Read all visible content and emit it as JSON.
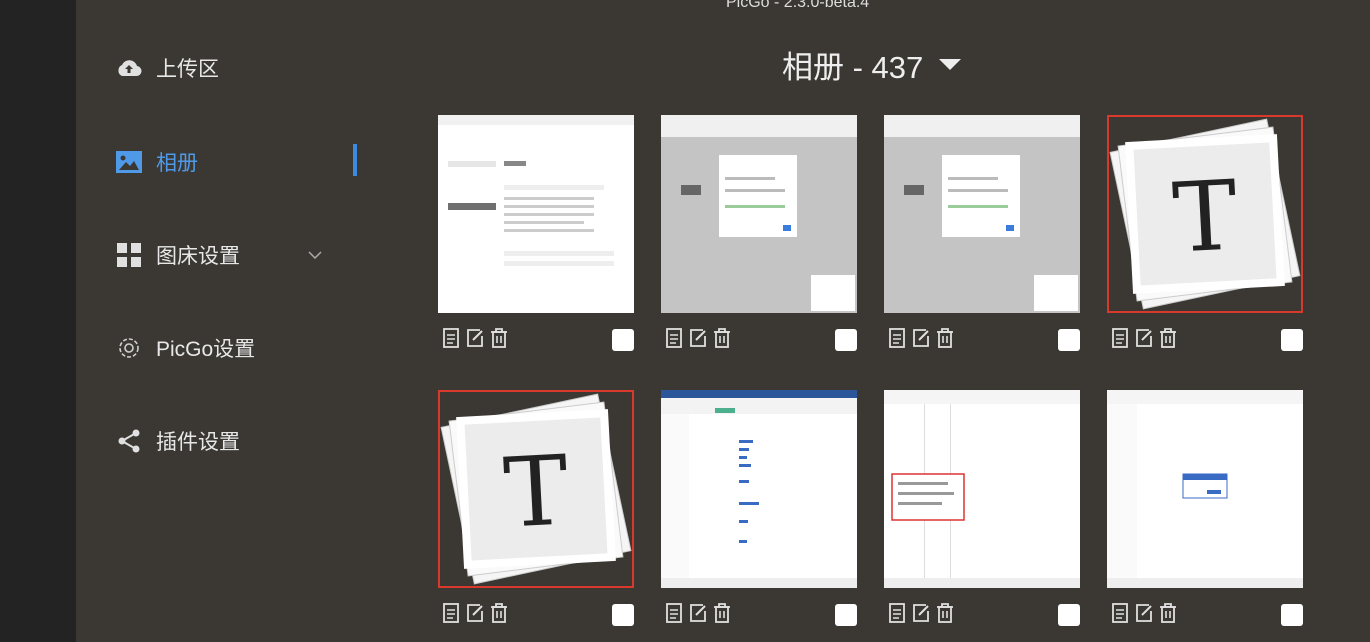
{
  "window": {
    "title": "PicGo - 2.3.0-beta.4"
  },
  "sidebar": {
    "items": [
      {
        "label": "上传区",
        "icon": "cloud-upload-icon"
      },
      {
        "label": "相册",
        "icon": "image-icon",
        "active": true
      },
      {
        "label": "图床设置",
        "icon": "grid-icon"
      },
      {
        "label": "PicGo设置",
        "icon": "gear-icon"
      },
      {
        "label": "插件设置",
        "icon": "share-icon"
      }
    ]
  },
  "gallery": {
    "title": "相册 - 437",
    "images": [
      {
        "kind": "screenshot-settings",
        "selected": false
      },
      {
        "kind": "screenshot-dialog",
        "selected": false
      },
      {
        "kind": "screenshot-dialog",
        "selected": false
      },
      {
        "kind": "typora-logo",
        "selected": true
      },
      {
        "kind": "typora-logo",
        "selected": true
      },
      {
        "kind": "screenshot-spreadsheet",
        "selected": false
      },
      {
        "kind": "screenshot-editor-menu",
        "selected": false
      },
      {
        "kind": "screenshot-editor-popup",
        "selected": false
      }
    ]
  },
  "colors": {
    "accent": "#4f9ae8",
    "selection_border": "#d9392b",
    "background": "#3b3833"
  }
}
